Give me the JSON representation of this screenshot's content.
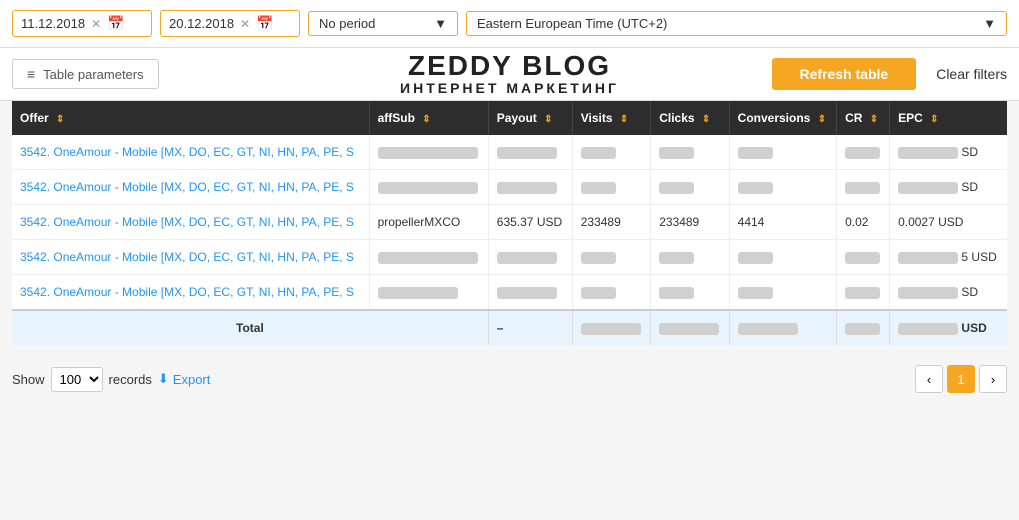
{
  "topbar": {
    "date_from": "11.12.2018",
    "date_to": "20.12.2018",
    "period_label": "No period",
    "timezone_label": "Eastern European Time (UTC+2)"
  },
  "secondbar": {
    "table_params_label": "Table parameters",
    "logo_title": "ZEDDY BLOG",
    "logo_sub": "ИНТЕРНЕТ МАРКЕТИНГ",
    "refresh_label": "Refresh table",
    "clear_label": "Clear filters"
  },
  "table": {
    "columns": [
      "Offer",
      "affSub",
      "Payout",
      "Visits",
      "Clicks",
      "Conversions",
      "CR",
      "EPC"
    ],
    "rows": [
      {
        "offer": "3542. OneAmour - Mobile [MX, DO, EC, GT, NI, HN, PA, PE, S",
        "affSub": "blurred-lg",
        "payout": "blurred-sm",
        "visits": "blurred-xs",
        "clicks": "blurred-xs",
        "conversions": "blurred-xs",
        "cr": "blurred-xs",
        "epc": "blurred-sm",
        "epc_suffix": "SD"
      },
      {
        "offer": "3542. OneAmour - Mobile [MX, DO, EC, GT, NI, HN, PA, PE, S",
        "affSub": "blurred-lg",
        "payout": "blurred-sm",
        "visits": "blurred-xs",
        "clicks": "blurred-xs",
        "conversions": "blurred-xs",
        "cr": "blurred-xs",
        "epc": "blurred-sm",
        "epc_suffix": "SD"
      },
      {
        "offer": "3542. OneAmour - Mobile [MX, DO, EC, GT, NI, HN, PA, PE, S",
        "affSub": "propellerMXCO",
        "payout": "635.37 USD",
        "visits": "233489",
        "clicks": "233489",
        "conversions": "4414",
        "cr": "0.02",
        "epc": "0.0027 USD",
        "epc_suffix": ""
      },
      {
        "offer": "3542. OneAmour - Mobile [MX, DO, EC, GT, NI, HN, PA, PE, S",
        "affSub": "blurred-lg",
        "payout": "blurred-sm",
        "visits": "blurred-xs",
        "clicks": "blurred-xs",
        "conversions": "blurred-xs",
        "cr": "blurred-xs",
        "epc": "blurred-sm",
        "epc_suffix": "5 USD"
      },
      {
        "offer": "3542. OneAmour - Mobile [MX, DO, EC, GT, NI, HN, PA, PE, S",
        "affSub": "blurred-md",
        "payout": "blurred-sm",
        "visits": "blurred-xs",
        "clicks": "blurred-xs",
        "conversions": "blurred-xs",
        "cr": "blurred-xs",
        "epc": "blurred-sm",
        "epc_suffix": "SD"
      }
    ],
    "footer": {
      "label": "Total",
      "dash": "–",
      "epc_suffix": "USD"
    }
  },
  "bottombar": {
    "show_label": "Show",
    "records_value": "100",
    "records_label": "records",
    "export_label": "Export",
    "page_current": "1"
  }
}
